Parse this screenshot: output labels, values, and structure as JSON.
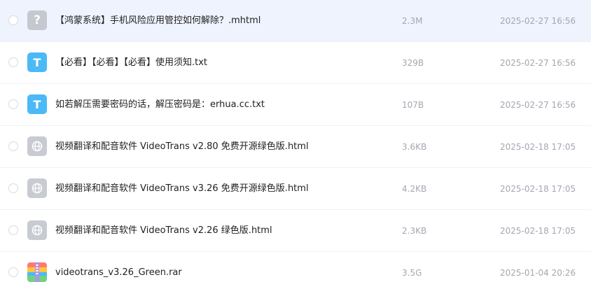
{
  "files": [
    {
      "icon": "unknown-file-icon",
      "glyph": "?",
      "name": "【鸿蒙系统】手机风险应用管控如何解除？.mhtml",
      "size": "2.3M",
      "date": "2025-02-27 16:56"
    },
    {
      "icon": "text-file-icon",
      "glyph": "T",
      "name": "【必看】【必看】【必看】使用须知.txt",
      "size": "329B",
      "date": "2025-02-27 16:56"
    },
    {
      "icon": "text-file-icon",
      "glyph": "T",
      "name": "如若解压需要密码的话，解压密码是：erhua.cc.txt",
      "size": "107B",
      "date": "2025-02-27 16:56"
    },
    {
      "icon": "web-file-icon",
      "glyph": "",
      "name": "视频翻译和配音软件 VideoTrans v2.80 免费开源绿色版.html",
      "size": "3.6KB",
      "date": "2025-02-18 17:05"
    },
    {
      "icon": "web-file-icon",
      "glyph": "",
      "name": "视频翻译和配音软件 VideoTrans v3.26 免费开源绿色版.html",
      "size": "4.2KB",
      "date": "2025-02-18 17:05"
    },
    {
      "icon": "web-file-icon",
      "glyph": "",
      "name": "视频翻译和配音软件 VideoTrans v2.26 绿色版.html",
      "size": "2.3KB",
      "date": "2025-02-18 17:05"
    },
    {
      "icon": "archive-file-icon",
      "glyph": "",
      "name": "videotrans_v3.26_Green.rar",
      "size": "3.5G",
      "date": "2025-01-04 20:26"
    }
  ],
  "colors": {
    "selected_row": "#eef3fd",
    "text_icon": "#4cb9f7",
    "gray_icon": "#c5c8cf",
    "meta_text": "#a3a7b0"
  }
}
